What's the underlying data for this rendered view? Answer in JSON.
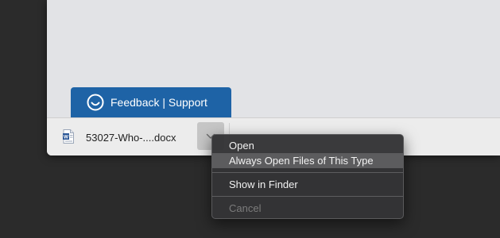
{
  "feedback": {
    "label": "Feedback | Support",
    "icon": "feedback-smile-icon",
    "color": "#1e63a6"
  },
  "download_shelf": {
    "file_name": "53027-Who-....docx",
    "file_icon": "word-document-icon",
    "dropdown_icon": "chevron-down-icon"
  },
  "context_menu": {
    "items": [
      {
        "label": "Open",
        "enabled": true,
        "highlighted": false
      },
      {
        "label": "Always Open Files of This Type",
        "enabled": true,
        "highlighted": true
      },
      {
        "label": "Show in Finder",
        "enabled": true,
        "highlighted": false
      },
      {
        "label": "Cancel",
        "enabled": false,
        "highlighted": false
      }
    ]
  }
}
